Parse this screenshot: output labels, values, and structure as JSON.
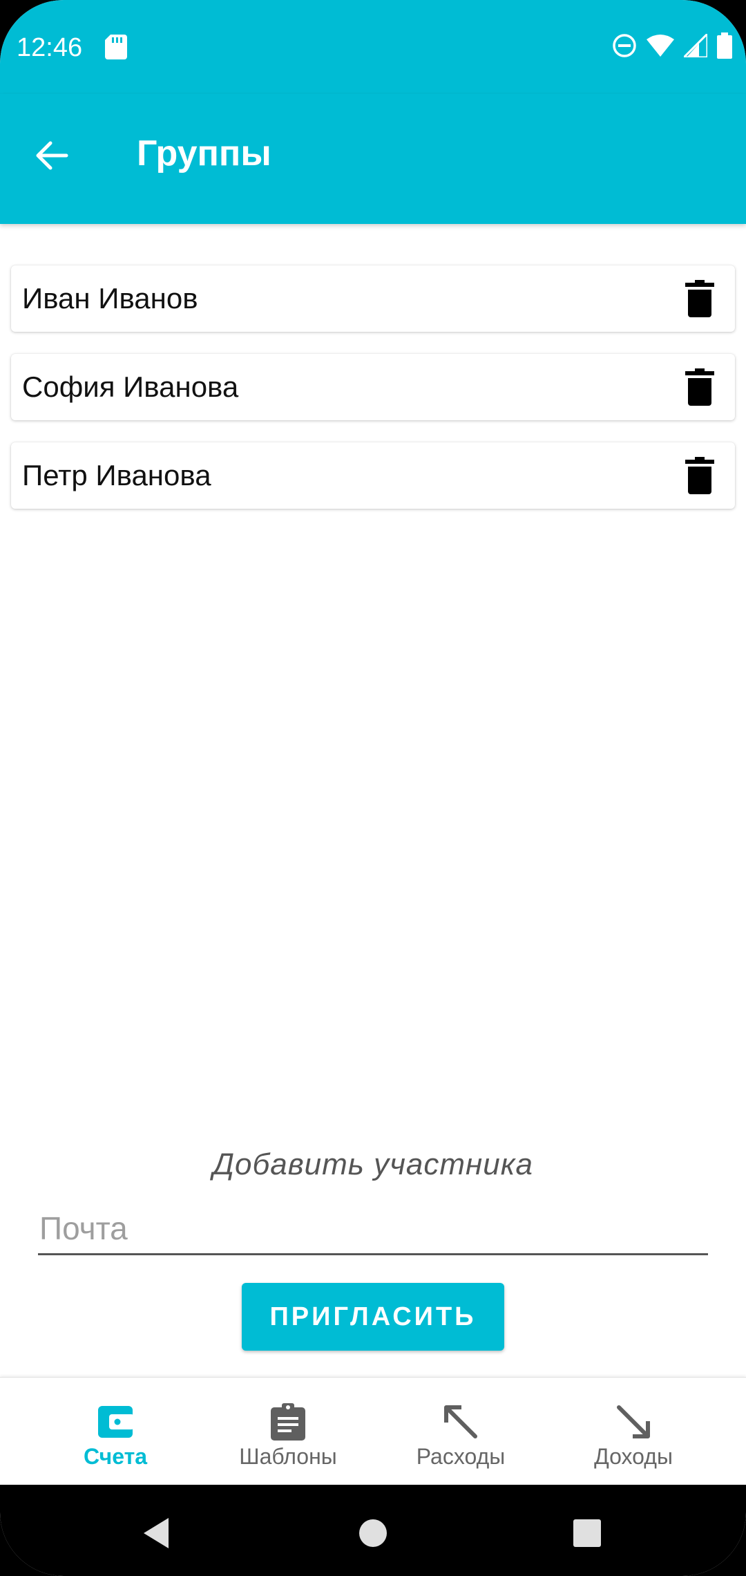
{
  "status_bar": {
    "time": "12:46"
  },
  "app_bar": {
    "title": "Группы"
  },
  "members": [
    {
      "name": "Иван Иванов"
    },
    {
      "name": "София Иванова"
    },
    {
      "name": "Петр Иванова"
    }
  ],
  "invite": {
    "title": "Добавить участника",
    "email_placeholder": "Почта",
    "email_value": "",
    "button_label": "ПРИГЛАСИТЬ"
  },
  "bottom_nav": {
    "items": [
      {
        "label": "Счета",
        "icon": "wallet-icon",
        "active": true
      },
      {
        "label": "Шаблоны",
        "icon": "clipboard-icon",
        "active": false
      },
      {
        "label": "Расходы",
        "icon": "arrow-up-left-icon",
        "active": false
      },
      {
        "label": "Доходы",
        "icon": "arrow-down-right-icon",
        "active": false
      }
    ]
  },
  "colors": {
    "primary": "#00BCD4",
    "inactive": "#666666"
  }
}
